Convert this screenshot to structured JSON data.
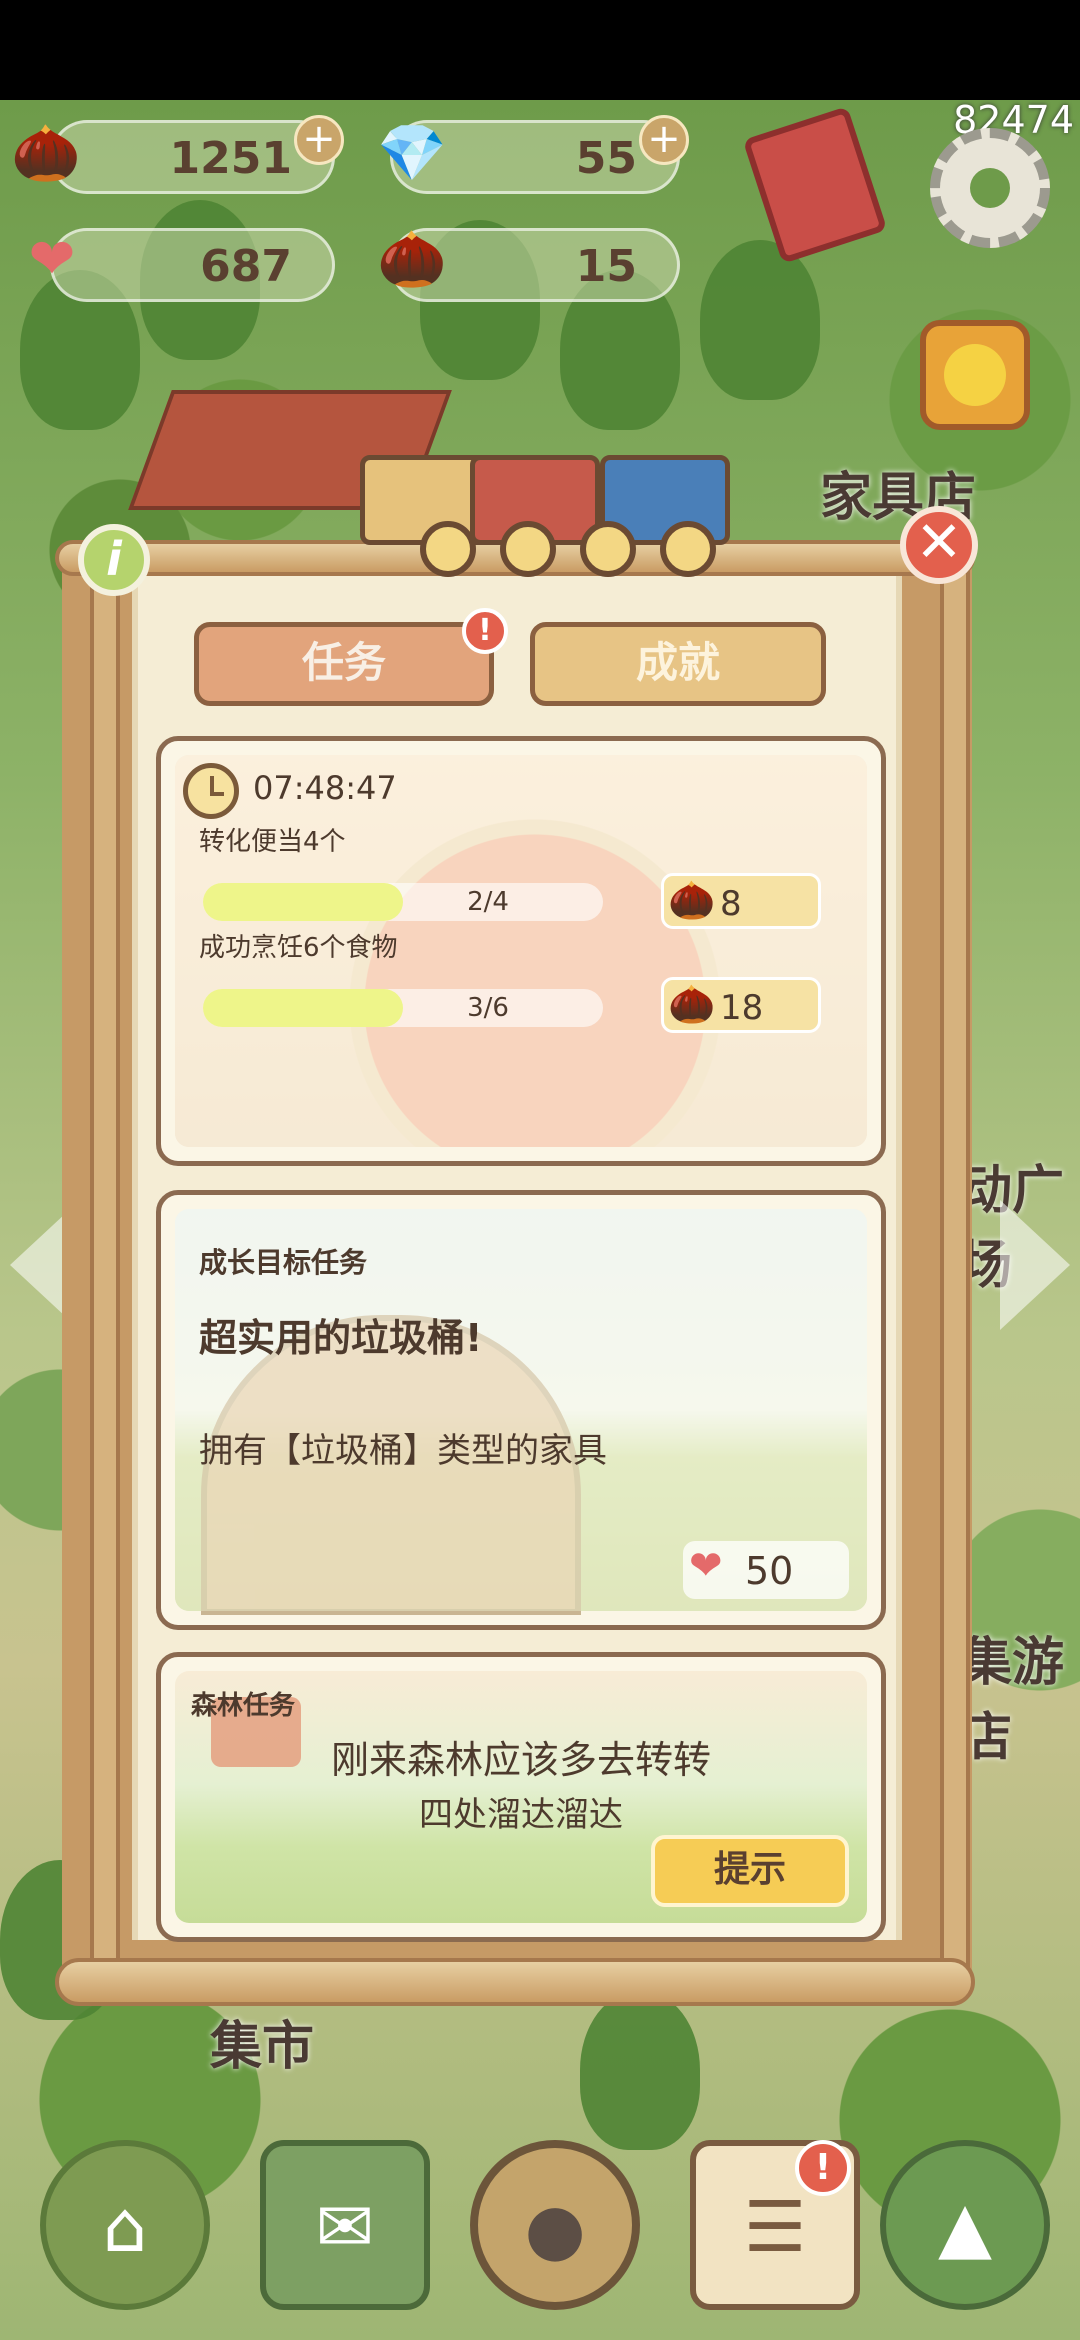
{
  "status": {
    "score": "82474"
  },
  "resources": [
    {
      "icon": "acorn-icon",
      "glyph": "🌰",
      "value": "1251",
      "plus": "+"
    },
    {
      "icon": "purple-gem-icon",
      "glyph": "💎",
      "value": "55",
      "plus": "+"
    },
    {
      "icon": "heart-gem-icon",
      "glyph": "❤",
      "value": "687"
    },
    {
      "icon": "chestnut-icon",
      "glyph": "🌰",
      "value": "15"
    }
  ],
  "map_labels": {
    "furniture_shop": "家具店",
    "plaza": "动广场",
    "amusement": "集游店",
    "market": "集市"
  },
  "dialog": {
    "info": "i",
    "close": "✕",
    "tabs": {
      "tasks": "任务",
      "achievements": "成就",
      "badge": "!"
    },
    "daily": {
      "timer": "07:48:47",
      "tasks": [
        {
          "name": "转化便当4个",
          "progress": "2/4",
          "reward": "8",
          "reward_icon": "🌰",
          "fraction": 0.5
        },
        {
          "name": "成功烹饪6个食物",
          "progress": "3/6",
          "reward": "18",
          "reward_icon": "🌰",
          "fraction": 0.5
        }
      ]
    },
    "growth": {
      "tag": "成长目标任务",
      "title": "超实用的垃圾桶!",
      "desc": "拥有【垃圾桶】类型的家具",
      "reward": "50",
      "reward_icon": "❤"
    },
    "forest": {
      "tag": "森林任务",
      "line1": "刚来森林应该多去转转",
      "line2": "四处溜达溜达",
      "hint": "提示"
    }
  },
  "nav": {
    "items": [
      {
        "name": "home",
        "glyph": "⌂"
      },
      {
        "name": "mail",
        "glyph": "✉"
      },
      {
        "name": "eggs",
        "glyph": "●"
      },
      {
        "name": "tasks",
        "glyph": "☰"
      },
      {
        "name": "map",
        "glyph": "▲"
      }
    ],
    "badge": "!"
  }
}
